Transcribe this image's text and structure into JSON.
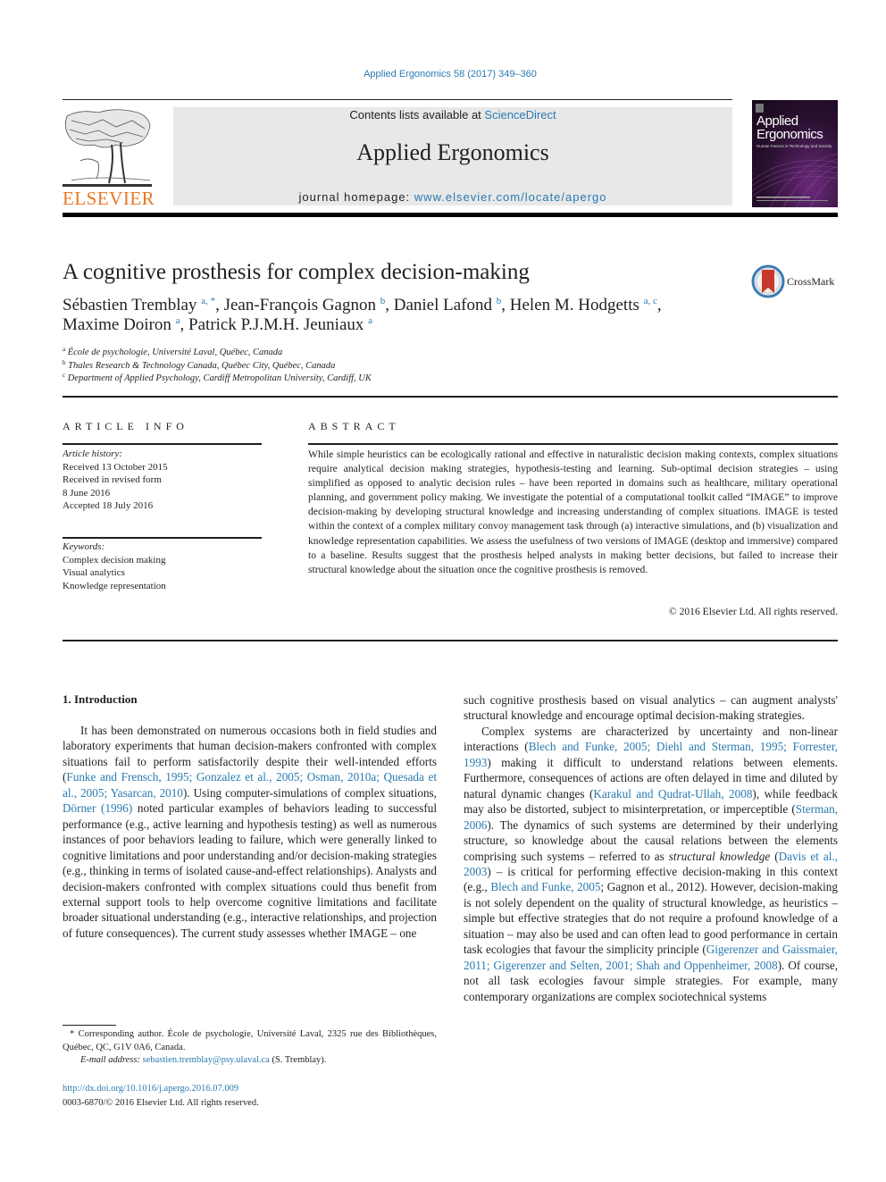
{
  "header": {
    "citation": "Applied Ergonomics 58 (2017) 349–360",
    "contents_prefix": "Contents lists available at ",
    "contents_link": "ScienceDirect",
    "journal_name": "Applied Ergonomics",
    "homepage_prefix": "journal homepage: ",
    "homepage_link": "www.elsevier.com/locate/apergo",
    "publisher_logo": "ELSEVIER",
    "cover": {
      "title_line1": "Applied",
      "title_line2": "Ergonomics",
      "subtitle": "Human Factors in Technology and Society"
    },
    "colors": {
      "link": "#2a7ab0",
      "elsevier_orange": "#e87722",
      "masthead_bg": "#e8e8e8"
    }
  },
  "article": {
    "title": "A cognitive prosthesis for complex decision-making",
    "crossmark_label": "CrossMark",
    "authors": [
      {
        "name": "Sébastien Tremblay",
        "sup": "a, *",
        "sep": ", "
      },
      {
        "name": "Jean-François Gagnon",
        "sup": "b",
        "sep": ", "
      },
      {
        "name": "Daniel Lafond",
        "sup": "b",
        "sep": ", "
      },
      {
        "name": "Helen M. Hodgetts",
        "sup": "a, c",
        "sep": ","
      },
      {
        "name": "Maxime Doiron",
        "sup": "a",
        "sep": ", "
      },
      {
        "name": "Patrick P.J.M.H. Jeuniaux",
        "sup": "a",
        "sep": ""
      }
    ],
    "affiliations": [
      {
        "key": "a",
        "text": "École de psychologie, Université Laval, Québec, Canada"
      },
      {
        "key": "b",
        "text": "Thales Research & Technology Canada, Québec City, Québec, Canada"
      },
      {
        "key": "c",
        "text": "Department of Applied Psychology, Cardiff Metropolitan University, Cardiff, UK"
      }
    ]
  },
  "article_info": {
    "heading": "ARTICLE INFO",
    "history_label": "Article history:",
    "history": [
      "Received 13 October 2015",
      "Received in revised form",
      "8 June 2016",
      "Accepted 18 July 2016"
    ],
    "keywords_label": "Keywords:",
    "keywords": [
      "Complex decision making",
      "Visual analytics",
      "Knowledge representation"
    ]
  },
  "abstract": {
    "heading": "ABSTRACT",
    "text": "While simple heuristics can be ecologically rational and effective in naturalistic decision making contexts, complex situations require analytical decision making strategies, hypothesis-testing and learning. Sub-optimal decision strategies – using simplified as opposed to analytic decision rules – have been reported in domains such as healthcare, military operational planning, and government policy making. We investigate the potential of a computational toolkit called “IMAGE” to improve decision-making by developing structural knowledge and increasing understanding of complex situations. IMAGE is tested within the context of a complex military convoy management task through (a) interactive simulations, and (b) visualization and knowledge representation capabilities. We assess the usefulness of two versions of IMAGE (desktop and immersive) compared to a baseline. Results suggest that the prosthesis helped analysts in making better decisions, but failed to increase their structural knowledge about the situation once the cognitive prosthesis is removed.",
    "copyright": "© 2016 Elsevier Ltd. All rights reserved."
  },
  "body": {
    "section_title": "1.  Introduction",
    "left_col": [
      {
        "t": "It has been demonstrated on numerous occasions both in field studies and laboratory experiments that human decision-makers confronted with complex situations fail to perform satisfactorily despite their well-intended efforts ("
      },
      {
        "link": "Funke and Frensch, 1995; Gonzalez et al., 2005; Osman, 2010a; Quesada et al., 2005; Yasarcan, 2010"
      },
      {
        "t": "). Using computer-simulations of complex situations, "
      },
      {
        "link": "Dörner (1996)"
      },
      {
        "t": " noted particular examples of behaviors leading to successful performance (e.g., active learning and hypothesis testing) as well as numerous instances of poor behaviors leading to failure, which were generally linked to cognitive limitations and poor understanding and/or decision-making strategies (e.g., thinking in terms of isolated cause-and-effect relationships). Analysts and decision-makers confronted with complex situations could thus benefit from external support tools to help overcome cognitive limitations and facilitate broader situational understanding (e.g., interactive relationships, and projection of future consequences). The current study assesses whether IMAGE – one"
      }
    ],
    "right_col_p1": "such cognitive prosthesis based on visual analytics – can augment analysts' structural knowledge and encourage optimal decision-making strategies.",
    "right_col_p2": [
      {
        "t": "Complex systems are characterized by uncertainty and non-linear interactions ("
      },
      {
        "link": "Blech and Funke, 2005; Diehl and Sterman, 1995; Forrester, 1993"
      },
      {
        "t": ") making it difficult to understand relations between elements. Furthermore, consequences of actions are often delayed in time and diluted by natural dynamic changes ("
      },
      {
        "link": "Karakul and Qudrat-Ullah, 2008"
      },
      {
        "t": "), while feedback may also be distorted, subject to misinterpretation, or imperceptible ("
      },
      {
        "link": "Sterman, 2006"
      },
      {
        "t": "). The dynamics of such systems are determined by their underlying structure, so knowledge about the causal relations between the elements comprising such systems – referred to as "
      },
      {
        "em": "structural knowledge"
      },
      {
        "t": " ("
      },
      {
        "link": "Davis et al., 2003"
      },
      {
        "t": ") – is critical for performing effective decision-making in this context (e.g., "
      },
      {
        "link": "Blech and Funke, 2005"
      },
      {
        "t": "; Gagnon et al., 2012). However, decision-making is not solely dependent on the quality of structural knowledge, as heuristics – simple but effective strategies that do not require a profound knowledge of a situation – may also be used and can often lead to good performance in certain task ecologies that favour the simplicity principle ("
      },
      {
        "link": "Gigerenzer and Gaissmaier, 2011; Gigerenzer and Selten, 2001; Shah and Oppenheimer, 2008"
      },
      {
        "t": "). Of course, not all task ecologies favour simple strategies. For example, many contemporary organizations are complex sociotechnical systems"
      }
    ]
  },
  "footnotes": {
    "corresponding": "* Corresponding author. École de psychologie, Université Laval, 2325 rue des Bibliothèques, Québec, QC, G1V 0A6, Canada.",
    "email_label": "E-mail address: ",
    "email": "sebastien.tremblay@psy.ulaval.ca",
    "email_suffix": " (S. Tremblay).",
    "doi": "http://dx.doi.org/10.1016/j.apergo.2016.07.009",
    "issn": "0003-6870/© 2016 Elsevier Ltd. All rights reserved."
  }
}
